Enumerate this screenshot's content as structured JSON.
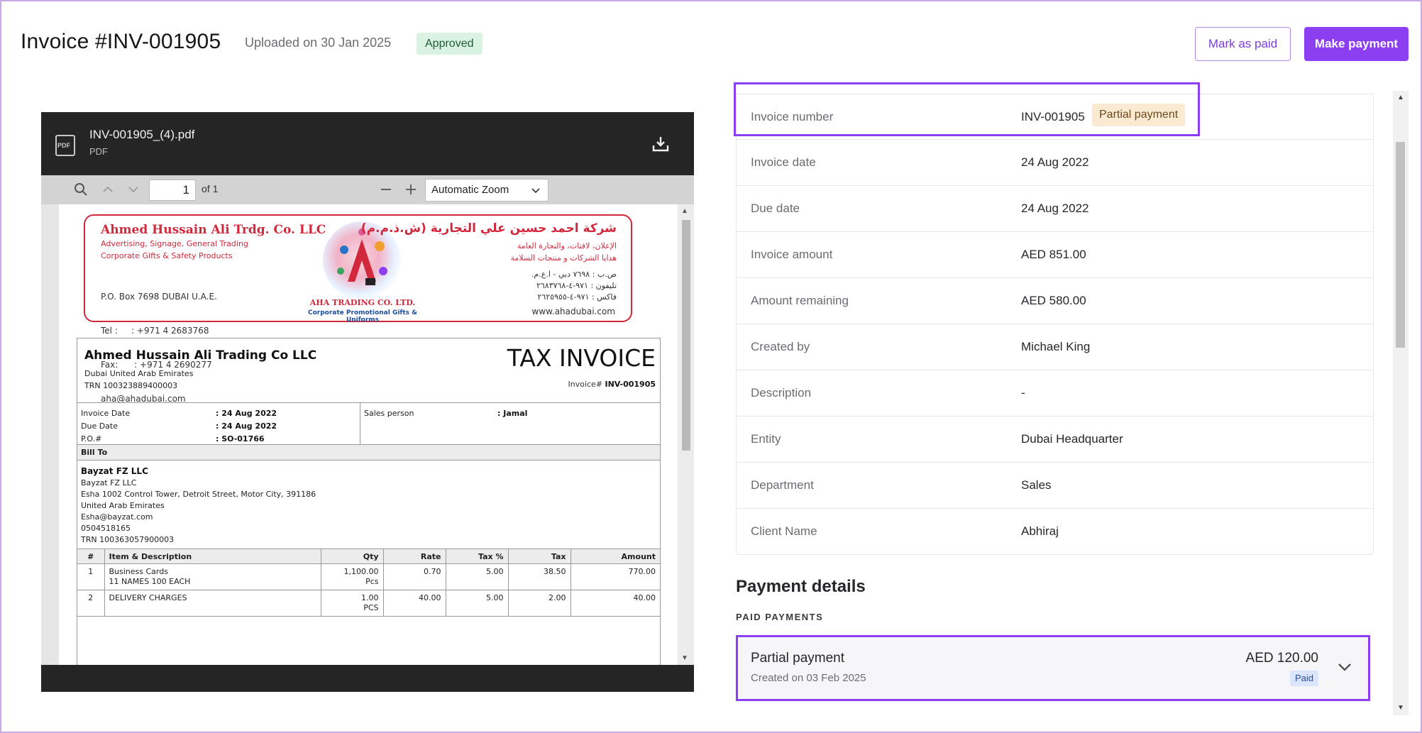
{
  "header": {
    "title": "Invoice #INV-001905",
    "uploaded": "Uploaded on 30 Jan 2025",
    "status": "Approved",
    "mark_paid_label": "Mark as paid",
    "make_payment_label": "Make payment"
  },
  "viewer": {
    "file_name": "INV-001905_(4).pdf",
    "file_type": "PDF",
    "file_icon_text": "PDF",
    "page_current": "1",
    "page_of": "of 1",
    "zoom": "Automatic Zoom"
  },
  "document": {
    "letterhead": {
      "en_title": "Ahmed Hussain Ali Trdg. Co. LLC",
      "en_sub1": "Advertising, Signage, General Trading",
      "en_sub2": "Corporate Gifts & Safety Products",
      "en_addr1": "P.O. Box 7698 DUBAI U.A.E.",
      "en_addr2": "Tel :     : +971 4 2683768",
      "en_addr3": "Fax:      : +971 4 2690277",
      "en_addr4": "aha@ahadubai.com",
      "ar_title": "شركة احمد حسين علي التجارية (ش.ذ.م.م)",
      "ar_sub1": "الإعلان، لافتات، والتجارة العامة",
      "ar_sub2": "هدايا الشركات و منتجات السلامة",
      "ar_addr1": "ص.ب : ٧٦٩٨ دبي - ا.ع.م.",
      "ar_addr2": "تليفون : ٩٧١-٤-٢٦٨٣٧٦٨",
      "ar_addr3": "فاكس : ٩٧١-٤-٢٦٢٥٩٥٥",
      "web": "www.ahadubai.com",
      "logo_name": "AHA TRADING CO. LTD.",
      "logo_tag": "Corporate Promotional Gifts & Uniforms"
    },
    "company": "Ahmed Hussain Ali Trading Co LLC",
    "company_addr": "Dubai United Arab Emirates",
    "company_trn": "TRN 100323889400003",
    "tax_title": "TAX INVOICE",
    "invoice_no_label": "Invoice#",
    "invoice_no": "INV-001905",
    "invoice_date_label": "Invoice Date",
    "invoice_date": ": 24 Aug 2022",
    "due_date_label": "Due Date",
    "due_date": ": 24 Aug 2022",
    "po_label": "P.O.#",
    "po": ": SO-01766",
    "sales_person_label": "Sales person",
    "sales_person": ": Jamal",
    "bill_to_label": "Bill To",
    "bill_name": "Bayzat FZ LLC",
    "bill_lines": [
      "Bayzat FZ LLC",
      "Esha 1002 Control Tower, Detroit Street, Motor City, 391186",
      "United Arab Emirates",
      "Esha@bayzat.com",
      "0504518165",
      "TRN 100363057900003"
    ],
    "columns": [
      "#",
      "Item & Description",
      "Qty",
      "Rate",
      "Tax %",
      "Tax",
      "Amount"
    ],
    "items": [
      {
        "no": "1",
        "item": "Business Cards",
        "desc": "11 NAMES 100 EACH",
        "qty": "1,100.00",
        "unit": "Pcs",
        "rate": "0.70",
        "taxp": "5.00",
        "tax": "38.50",
        "amount": "770.00"
      },
      {
        "no": "2",
        "item": "DELIVERY CHARGES",
        "desc": "",
        "qty": "1.00",
        "unit": "PCS",
        "rate": "40.00",
        "taxp": "5.00",
        "tax": "2.00",
        "amount": "40.00"
      }
    ]
  },
  "details": [
    {
      "label": "Invoice number",
      "value": "INV-001905",
      "badge": "Partial payment"
    },
    {
      "label": "Invoice date",
      "value": "24 Aug 2022"
    },
    {
      "label": "Due date",
      "value": "24 Aug 2022"
    },
    {
      "label": "Invoice amount",
      "value": "AED 851.00"
    },
    {
      "label": "Amount remaining",
      "value": "AED 580.00"
    },
    {
      "label": "Created by",
      "value": "Michael King"
    },
    {
      "label": "Description",
      "value": "-"
    },
    {
      "label": "Entity",
      "value": "Dubai Headquarter"
    },
    {
      "label": "Department",
      "value": "Sales"
    },
    {
      "label": "Client Name",
      "value": "Abhiraj"
    }
  ],
  "payments": {
    "title": "Payment details",
    "subtitle": "PAID PAYMENTS",
    "items": [
      {
        "name": "Partial payment",
        "created": "Created on 03 Feb 2025",
        "amount": "AED 120.00",
        "status": "Paid"
      }
    ]
  },
  "colors": {
    "accent": "#8c3ff0",
    "approved_bg": "#d9f2e2",
    "partial_bg": "#fbead2",
    "paid_bg": "#dbe5fb",
    "letterhead_red": "#d1283b"
  },
  "icons": [
    "pdf-file-icon",
    "download-icon",
    "search-icon",
    "chevron-up-icon",
    "chevron-down-icon",
    "zoom-out-icon",
    "zoom-in-icon",
    "expand-chevron-icon"
  ]
}
